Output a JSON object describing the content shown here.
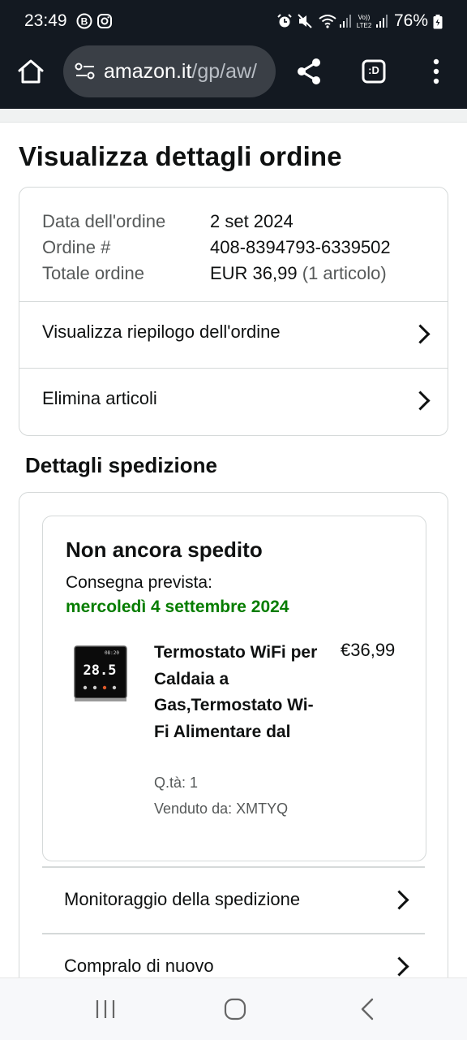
{
  "status_bar": {
    "time": "23:49",
    "battery": "76%",
    "icons": [
      "b-notification-icon",
      "instagram-icon",
      "alarm-icon",
      "mute-icon",
      "wifi-icon",
      "signal-icon",
      "volte-icon",
      "signal-icon-2",
      "battery-icon"
    ]
  },
  "browser": {
    "url_domain": "amazon.it",
    "url_path": "/gp/aw/",
    "tab_count_label": ":D"
  },
  "page": {
    "title": "Visualizza dettagli ordine"
  },
  "order": {
    "rows": [
      {
        "label": "Data dell'ordine",
        "value": "2 set 2024"
      },
      {
        "label": "Ordine #",
        "value": "408-8394793-6339502"
      },
      {
        "label": "Totale ordine",
        "value": "EUR 36,99",
        "extra": "(1 articolo)"
      }
    ],
    "links": [
      {
        "label": "Visualizza riepilogo dell'ordine"
      },
      {
        "label": "Elimina articoli"
      }
    ]
  },
  "shipment": {
    "section_title": "Dettagli spedizione",
    "status": "Non ancora spedito",
    "eta_label": "Consegna prevista:",
    "eta_date": "mercoledì 4 settembre 2024",
    "product": {
      "title": "Termostato WiFi per Caldaia a Gas,Termostato Wi-Fi Alimentare dal",
      "price": "€36,99",
      "qty": "Q.tà: 1",
      "seller": "Venduto da: XMTYQ",
      "thumb_display": "28.5",
      "thumb_clock": "08:20"
    },
    "actions": [
      {
        "label": "Monitoraggio della spedizione"
      },
      {
        "label": "Compralo di nuovo"
      }
    ]
  },
  "colors": {
    "header_bg": "#131921",
    "delivery_green": "#067d00",
    "border": "#d5d9d9"
  }
}
